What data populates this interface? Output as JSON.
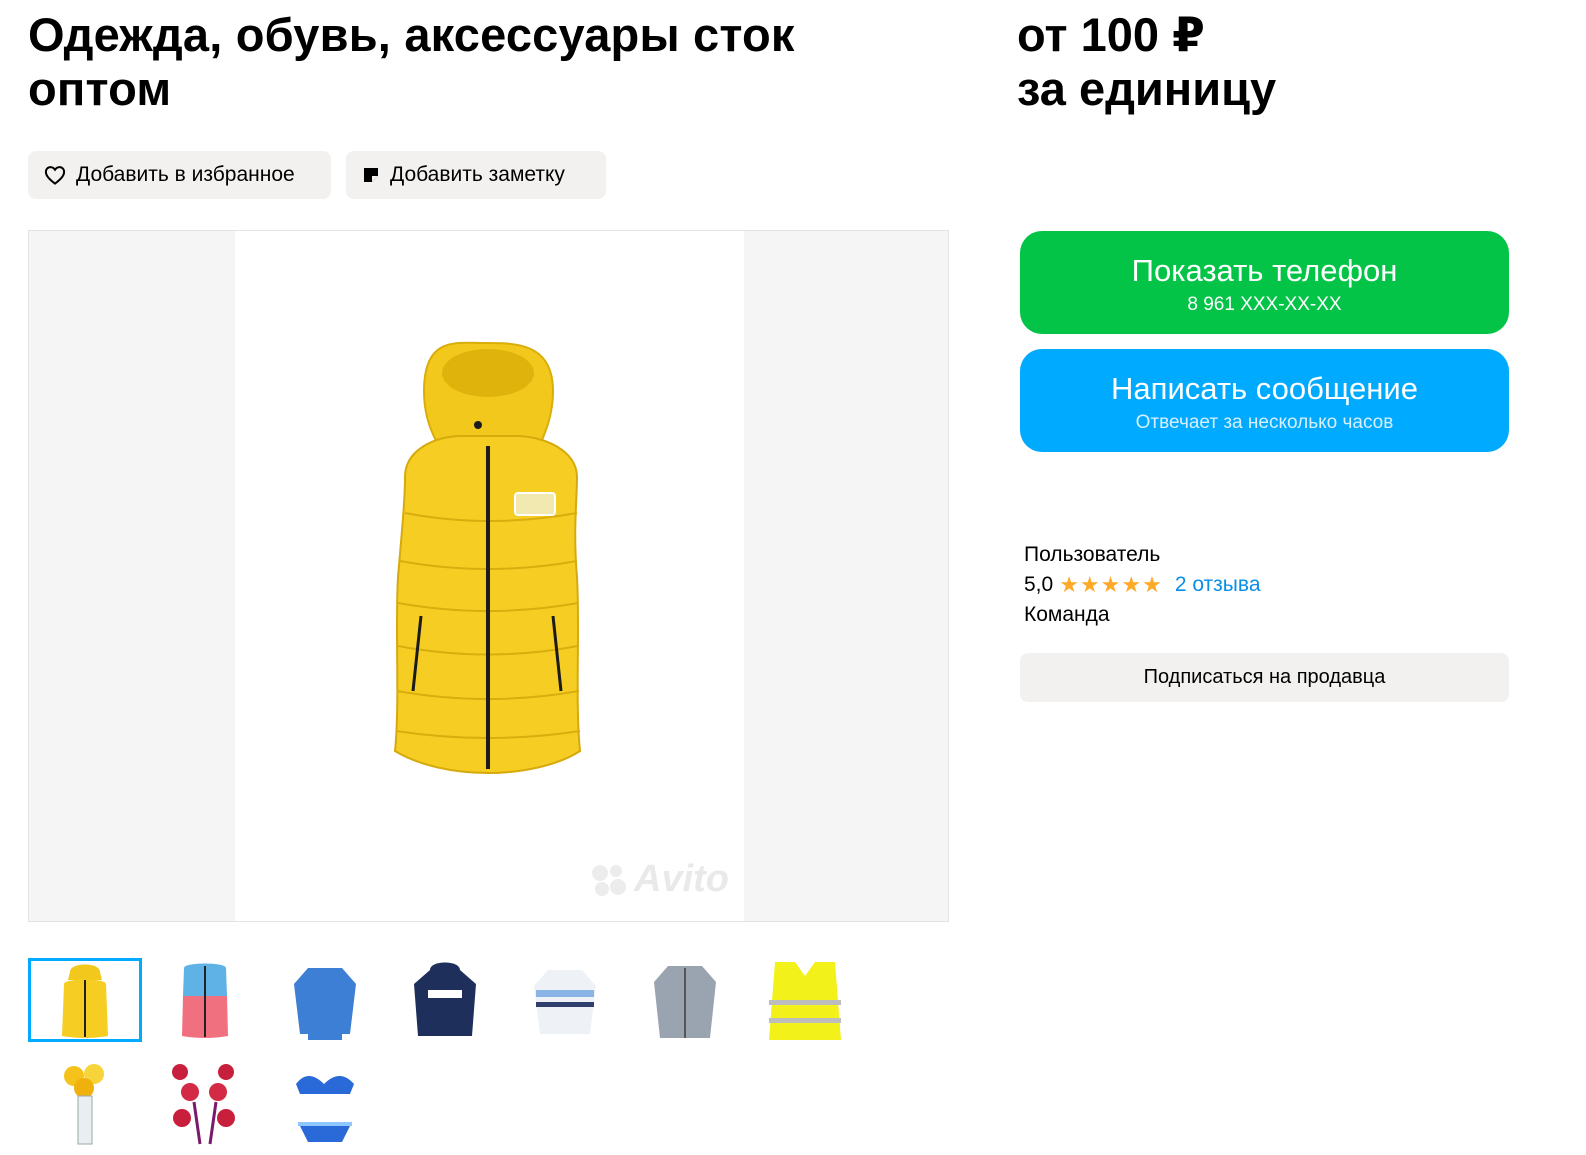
{
  "listing": {
    "title": "Одежда, обувь, аксессуары сток оптом",
    "price_line1": "от 100 ₽",
    "price_line2": "за единицу"
  },
  "actions": {
    "favorite_label": "Добавить в избранное",
    "note_label": "Добавить заметку"
  },
  "gallery": {
    "watermark": "Avito",
    "thumbnails": [
      "yellow-vest",
      "pink-blue-vest",
      "blue-sweater",
      "navy-hoodie",
      "striped-sweater",
      "grey-jacket",
      "safety-vest",
      "flowers",
      "red-flowers",
      "blue-swimsuit"
    ],
    "active_index": 0
  },
  "contact": {
    "phone_title": "Показать телефон",
    "phone_number": "8 961 XXX-XX-XX",
    "message_title": "Написать сообщение",
    "message_subtitle": "Отвечает за несколько часов"
  },
  "seller": {
    "type": "Пользователь",
    "rating": "5,0",
    "stars": "★★★★★",
    "reviews": "2 отзыва",
    "team": "Команда",
    "subscribe_label": "Подписаться на продавца"
  },
  "colors": {
    "green": "#04c448",
    "blue": "#00aaff",
    "star": "#ffa928",
    "link": "#0a8ee6"
  }
}
